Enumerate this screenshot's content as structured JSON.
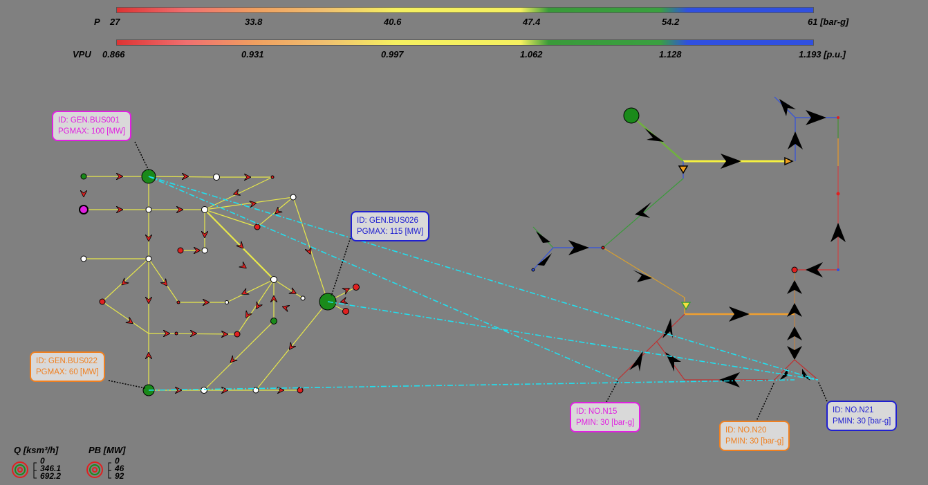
{
  "scales": {
    "pressure": {
      "label": "P",
      "ticks": [
        "27",
        "33.8",
        "40.6",
        "47.4",
        "54.2",
        "61 [bar-g]"
      ]
    },
    "voltage": {
      "label": "VPU",
      "ticks": [
        "0.866",
        "0.931",
        "0.997",
        "1.062",
        "1.128",
        "1.193 [p.u.]"
      ]
    }
  },
  "callouts": {
    "gen_bus001": {
      "id": "ID: GEN.BUS001",
      "param": "PGMAX: 100 [MW]",
      "color": "#e020e0"
    },
    "gen_bus026": {
      "id": "ID: GEN.BUS026",
      "param": "PGMAX: 115 [MW]",
      "color": "#2020d0"
    },
    "gen_bus022": {
      "id": "ID: GEN.BUS022",
      "param": "PGMAX: 60 [MW]",
      "color": "#f08020"
    },
    "no_n15": {
      "id": "ID: NO.N15",
      "param": "PMIN: 30 [bar-g]",
      "color": "#e020e0"
    },
    "no_n20": {
      "id": "ID: NO.N20",
      "param": "PMIN: 30 [bar-g]",
      "color": "#f08020"
    },
    "no_n21": {
      "id": "ID: NO.N21",
      "param": "PMIN: 30 [bar-g]",
      "color": "#2020d0"
    }
  },
  "legend": {
    "gas": {
      "title": "Q [ksm³/h]",
      "values": [
        "0",
        "346.1",
        "692.2"
      ]
    },
    "power": {
      "title": "PB [MW]",
      "values": [
        "0",
        "46",
        "92"
      ]
    }
  }
}
